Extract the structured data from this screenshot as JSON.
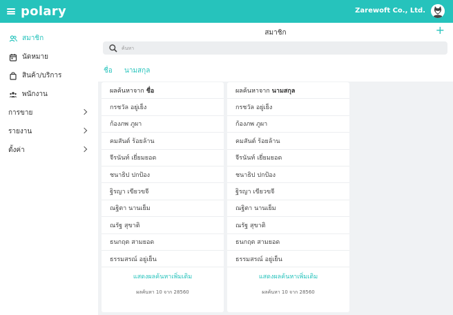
{
  "app": {
    "logo": "polary",
    "company": "Zarewoft Co., Ltd."
  },
  "sidebar": {
    "items": [
      {
        "label": "สมาชิก",
        "icon": "members-icon",
        "active": true
      },
      {
        "label": "นัดหมาย",
        "icon": "calendar-icon"
      },
      {
        "label": "สินค้า/บริการ",
        "icon": "bag-icon"
      },
      {
        "label": "พนักงาน",
        "icon": "staff-icon"
      },
      {
        "label": "การขาย",
        "icon": "chevron-right-icon"
      },
      {
        "label": "รายงาน",
        "icon": "chevron-right-icon"
      },
      {
        "label": "ตั้งค่า",
        "icon": "chevron-right-icon"
      }
    ]
  },
  "header": {
    "title": "สมาชิก",
    "add": "+"
  },
  "search": {
    "placeholder": "ค้นหา"
  },
  "tabs": [
    "ชื่อ",
    "นามสกุล"
  ],
  "columns": [
    {
      "heading_prefix": "ผลค้นหาจาก",
      "heading_field": "ชื่อ",
      "results": [
        "กรชวัล อยู่เย็ง",
        "ก้องภพ ภูผา",
        "คมสันต์ ร้อยล้าน",
        "จีรนันท์ เยี่ยมยอด",
        "ชนาธิป ปกป้อง",
        "ฐิรญา เขียวขจี",
        "ณฐิตา นานเย็ม",
        "ณรัฐ สุขาติ",
        "ธนกฤต สามยอด",
        "ธรรมสรณ์ อยู่เย็น"
      ],
      "more": "แสดงผลค้นหาเพิ่มเติม",
      "count": "ผลค้นหา 10 จาก 28560"
    },
    {
      "heading_prefix": "ผลค้นหาจาก",
      "heading_field": "นามสกุล",
      "results": [
        "กรชวัล อยู่เย็ง",
        "ก้องภพ ภูผา",
        "คมสันต์ ร้อยล้าน",
        "จีรนันท์ เยี่ยมยอด",
        "ชนาธิป ปกป้อง",
        "ฐิรญา เขียวขจี",
        "ณฐิตา นานเย็ม",
        "ณรัฐ สุขาติ",
        "ธนกฤต สามยอด",
        "ธรรมสรณ์ อยู่เย็น"
      ],
      "more": "แสดงผลค้นหาเพิ่มเติม",
      "count": "ผลค้นหา 10 จาก 28560"
    }
  ],
  "colors": {
    "accent": "#26c3bc",
    "background": "#f0f2f4"
  }
}
